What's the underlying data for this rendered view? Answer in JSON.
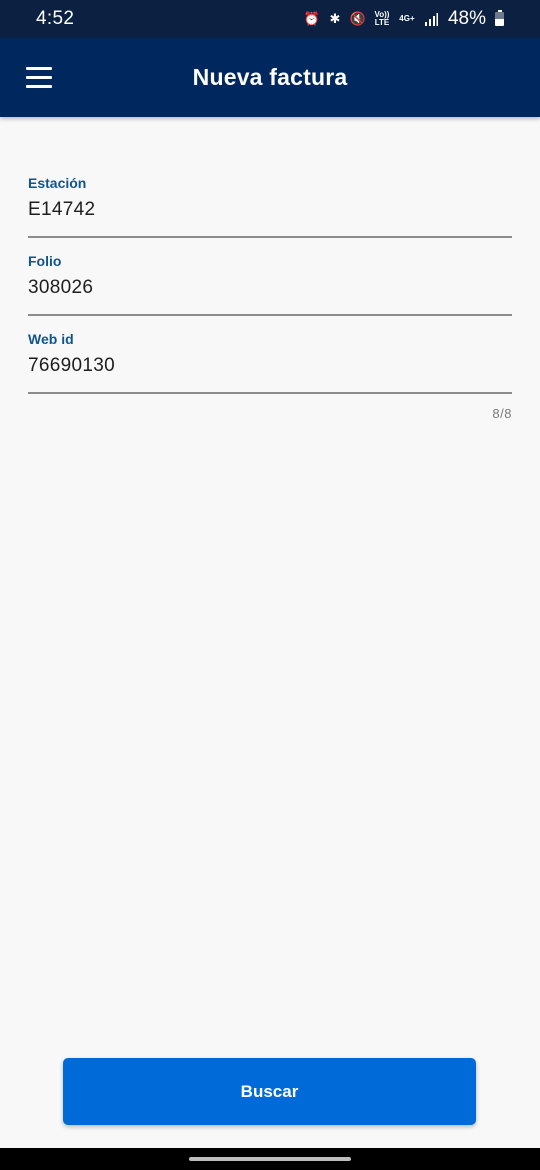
{
  "status_bar": {
    "time": "4:52",
    "battery": "48%",
    "icons": [
      "alarm-icon",
      "bluetooth-icon",
      "mute-icon",
      "volte-icon",
      "4g-plus-icon",
      "signal-icon",
      "battery-icon"
    ],
    "volte_label_top": "Vo))",
    "volte_label_bottom": "LTE",
    "network_label": "4G+"
  },
  "app_bar": {
    "title": "Nueva factura",
    "menu_icon": "hamburger-menu-icon",
    "background": "#00285e"
  },
  "form": {
    "fields": [
      {
        "label": "Estación",
        "value": "E14742"
      },
      {
        "label": "Folio",
        "value": "308026"
      },
      {
        "label": "Web id",
        "value": "76690130"
      }
    ],
    "counter": "8/8",
    "label_color": "#11558f"
  },
  "actions": {
    "search_label": "Buscar",
    "button_color": "#006ad8"
  }
}
